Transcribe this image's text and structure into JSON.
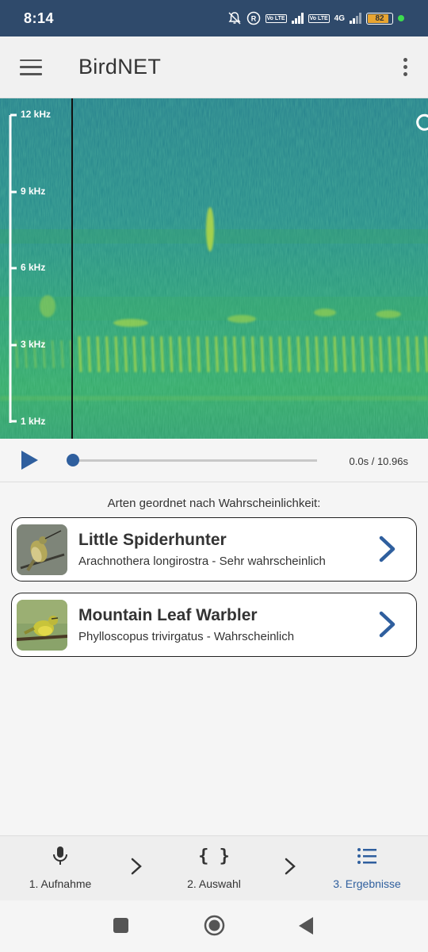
{
  "status_bar": {
    "time": "8:14",
    "battery_level": "82",
    "network_label": "4G",
    "volte_label": "Vo LTE"
  },
  "app_bar": {
    "title": "BirdNET"
  },
  "spectrogram": {
    "frequency_labels": [
      "12 kHz",
      "9 kHz",
      "6 kHz",
      "3 kHz",
      "1 kHz"
    ],
    "colors": {
      "low": "#1f7f8a",
      "mid": "#2a9b6e",
      "high": "#c9e23a"
    }
  },
  "player": {
    "time_readout": "0.0s / 10.96s",
    "progress": 0.0
  },
  "results": {
    "heading": "Arten geordnet nach Wahrscheinlichkeit:",
    "items": [
      {
        "common_name": "Little Spiderhunter",
        "detail": "Arachnothera longirostra - Sehr wahrscheinlich"
      },
      {
        "common_name": "Mountain Leaf Warbler",
        "detail": "Phylloscopus trivirgatus - Wahrscheinlich"
      }
    ]
  },
  "bottom_nav": {
    "items": [
      {
        "label": "1. Aufnahme",
        "icon": "microphone-icon"
      },
      {
        "label": "2. Auswahl",
        "icon": "braces-icon"
      },
      {
        "label": "3. Ergebnisse",
        "icon": "list-icon",
        "active": true
      }
    ]
  },
  "colors": {
    "status_bar": "#2f4a6b",
    "accent": "#2f5f9e"
  }
}
